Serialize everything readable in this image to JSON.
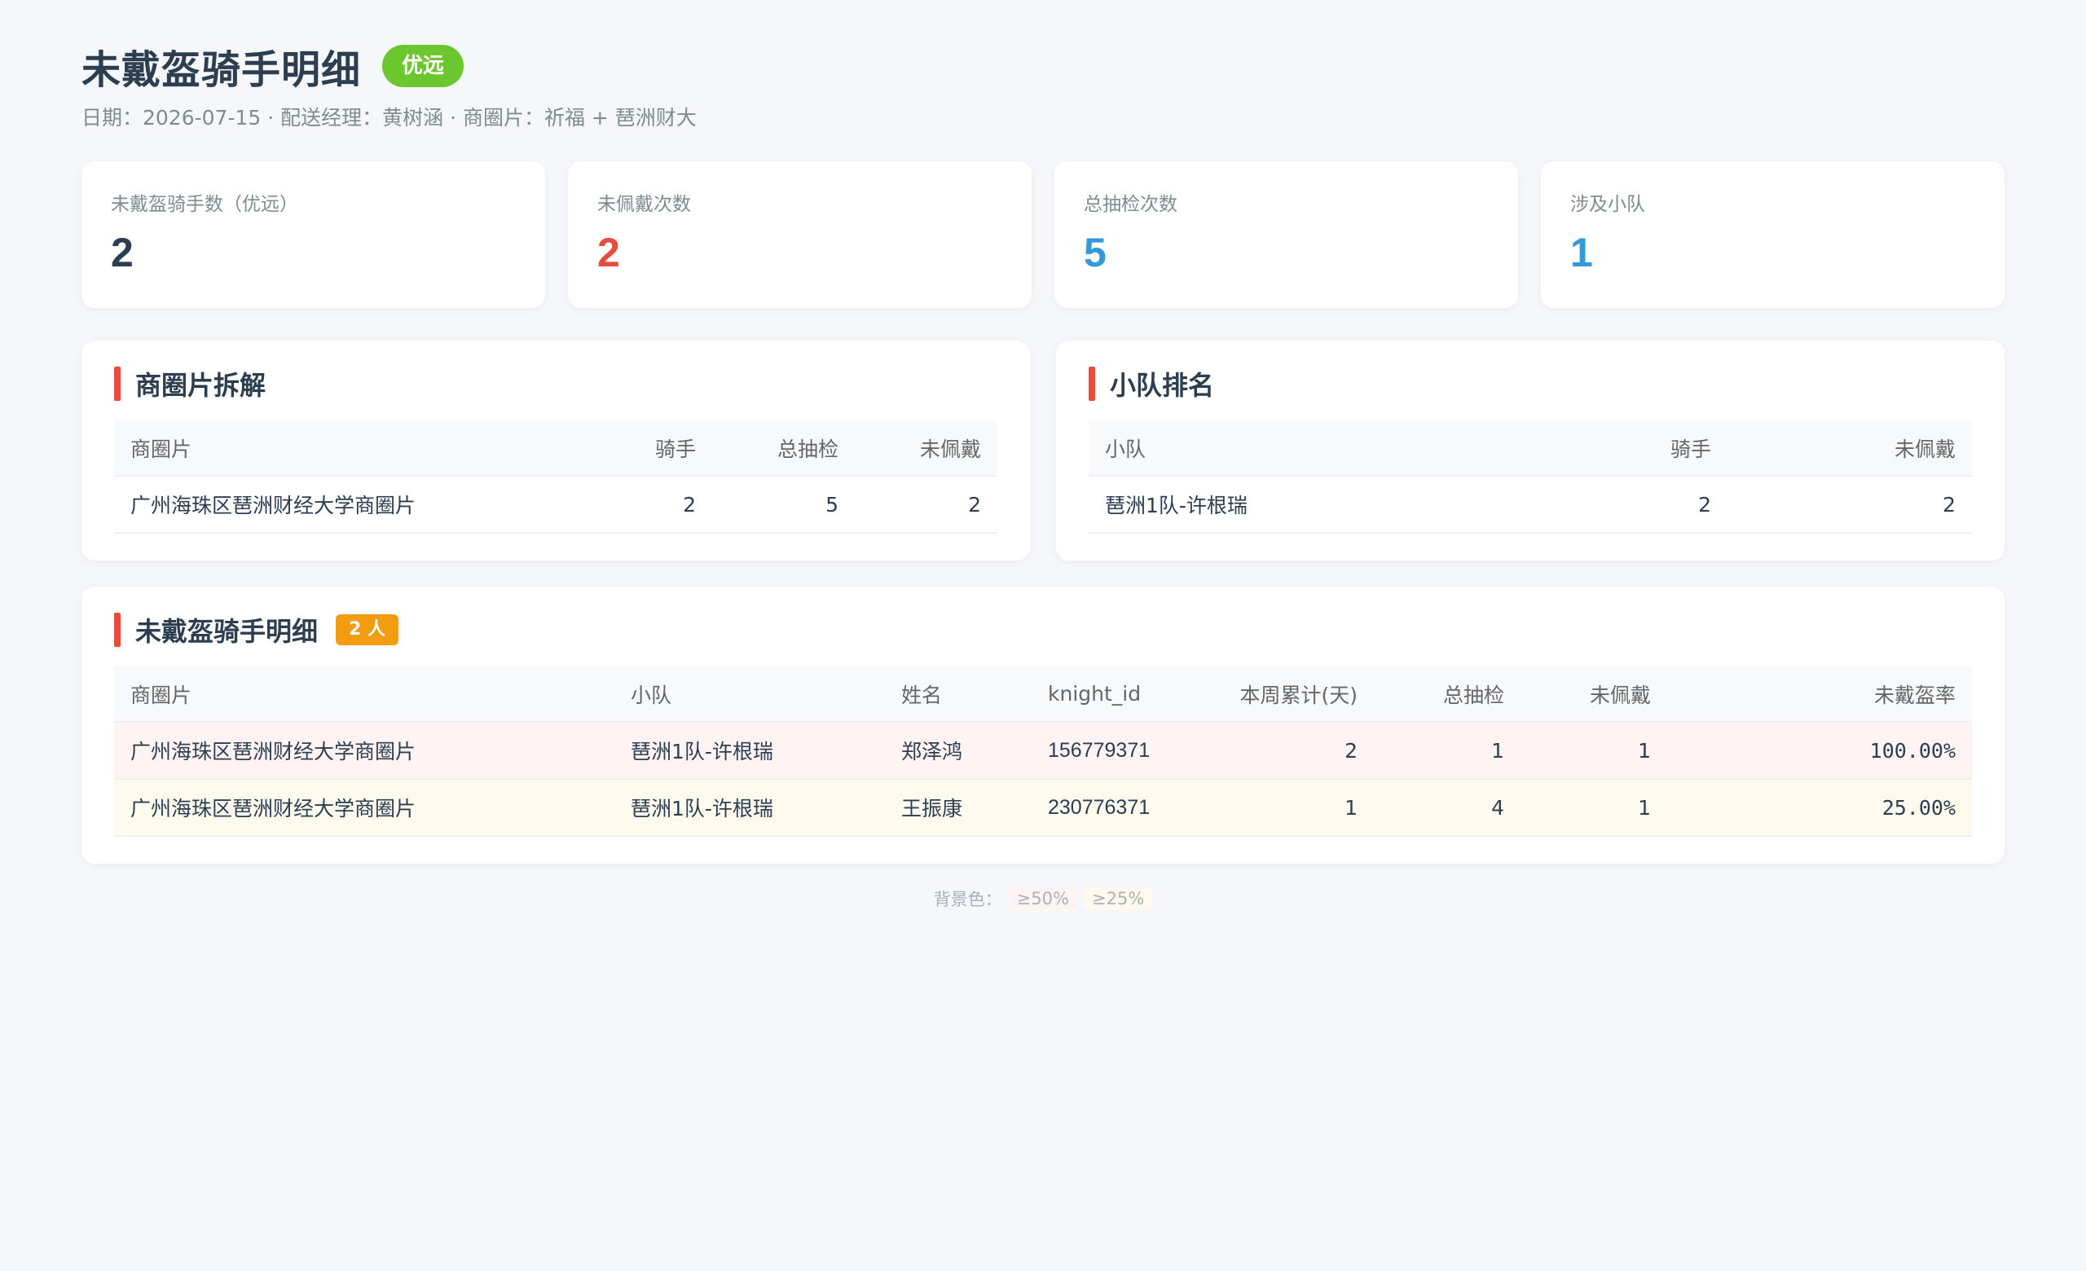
{
  "header": {
    "title": "未戴盔骑手明细",
    "badge": "优远",
    "subtitle": "日期：2026-07-15 · 配送经理：黄树涵 · 商圈片：祈福 + 琶洲财大"
  },
  "stats": [
    {
      "label": "未戴盔骑手数（优远）",
      "value": "2",
      "color": "#2c3e50"
    },
    {
      "label": "未佩戴次数",
      "value": "2",
      "color": "#e74c3c"
    },
    {
      "label": "总抽检次数",
      "value": "5",
      "color": "#3498db"
    },
    {
      "label": "涉及小队",
      "value": "1",
      "color": "#3498db"
    }
  ],
  "district_panel": {
    "title": "商圈片拆解",
    "columns": [
      "商圈片",
      "骑手",
      "总抽检",
      "未佩戴"
    ],
    "rows": [
      [
        "广州海珠区琶洲财经大学商圈片",
        "2",
        "5",
        "2"
      ]
    ]
  },
  "team_panel": {
    "title": "小队排名",
    "columns": [
      "小队",
      "骑手",
      "未佩戴"
    ],
    "rows": [
      [
        "琶洲1队-许根瑞",
        "2",
        "2"
      ]
    ]
  },
  "detail_panel": {
    "title": "未戴盔骑手明细",
    "count_badge": "2 人",
    "columns": [
      "商圈片",
      "小队",
      "姓名",
      "knight_id",
      "本周累计(天)",
      "总抽检",
      "未佩戴",
      "未戴盔率"
    ],
    "rows": [
      [
        "广州海珠区琶洲财经大学商圈片",
        "琶洲1队-许根瑞",
        "郑泽鸿",
        "156779371",
        "2",
        "1",
        "1",
        "100.00%"
      ],
      [
        "广州海珠区琶洲财经大学商圈片",
        "琶洲1队-许根瑞",
        "王振康",
        "230776371",
        "1",
        "4",
        "1",
        "25.00%"
      ]
    ]
  },
  "legend": {
    "label": "背景色：",
    "high": "≥50%",
    "mid": "≥25%"
  },
  "colors": {
    "accent_bar": "#e74c3c",
    "badge_green": "#6cc62d",
    "badge_orange": "#f39c12",
    "row_high_bg": "#fff4f3",
    "row_mid_bg": "#fffaee"
  }
}
